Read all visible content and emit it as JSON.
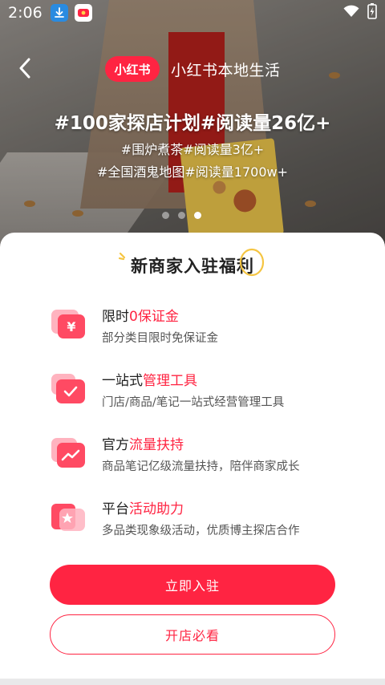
{
  "status_bar": {
    "time": "2:06",
    "icons": [
      "download-icon",
      "xiaohongshu-app-icon",
      "wifi-icon",
      "battery-icon"
    ]
  },
  "nav": {
    "back_icon": "chevron-left-icon",
    "brand_logo": "小红书",
    "title": "小红书本地生活"
  },
  "hero": {
    "headline": "#100家探店计划#阅读量26亿+",
    "line2": "#围炉煮茶#阅读量3亿+",
    "line3": "#全国酒鬼地图#阅读量1700w+",
    "carousel": {
      "count": 3,
      "active_index": 2
    }
  },
  "sheet": {
    "title": "新商家入驻福利",
    "benefits": [
      {
        "icon": "yen-card-icon",
        "title_prefix": "限时",
        "title_highlight": "0保证金",
        "desc": "部分类目限时免保证金"
      },
      {
        "icon": "check-folder-icon",
        "title_prefix": "一站式",
        "title_highlight": "管理工具",
        "desc": "门店/商品/笔记一站式经营管理工具"
      },
      {
        "icon": "trend-chart-icon",
        "title_prefix": "官方",
        "title_highlight": "流量扶持",
        "desc": "商品笔记亿级流量扶持，陪伴商家成长"
      },
      {
        "icon": "star-flag-icon",
        "title_prefix": "平台",
        "title_highlight": "活动助力",
        "desc": "多品类现象级活动，优质博主探店合作"
      }
    ],
    "primary_button": "立即入驻",
    "secondary_button": "开店必看"
  },
  "colors": {
    "accent": "#ff2442",
    "title_text": "#222222",
    "desc_text": "#555555",
    "sheet_bg": "#ffffff",
    "decor_yellow": "#f5c542"
  }
}
